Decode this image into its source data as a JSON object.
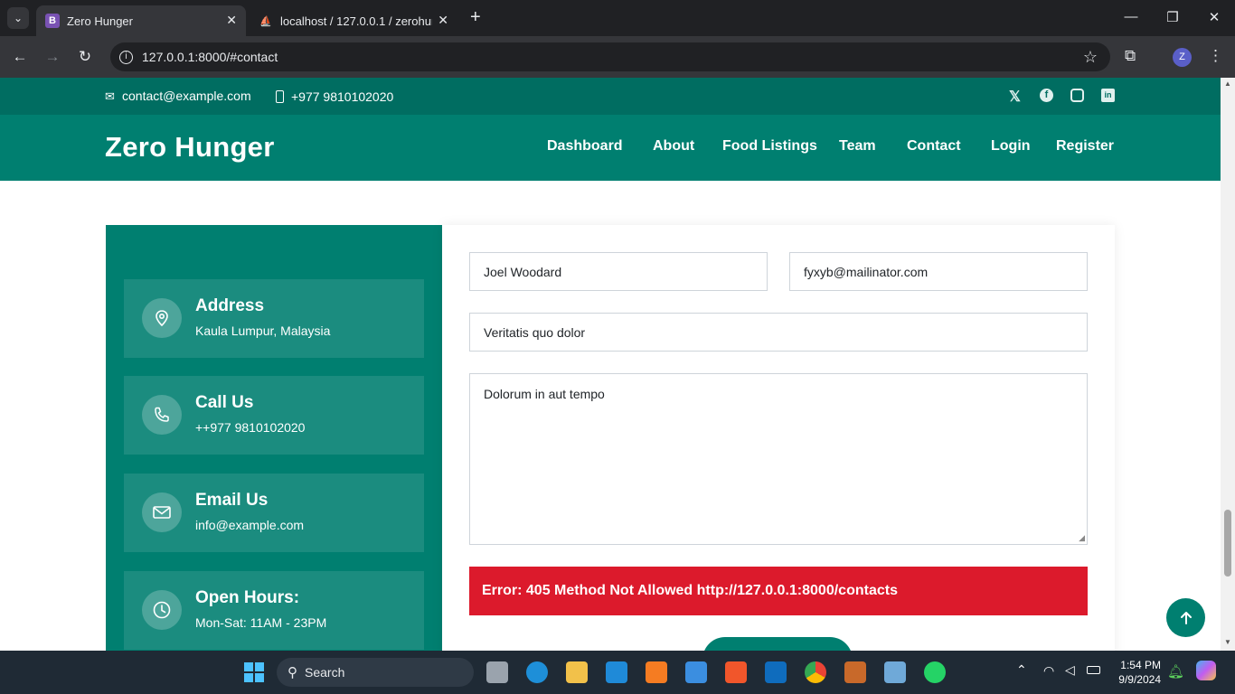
{
  "browser": {
    "tabs": [
      {
        "label": "Zero Hunger",
        "favicon": "B",
        "active": true
      },
      {
        "label": "localhost / 127.0.0.1 / zerohung",
        "active": false
      }
    ],
    "new_tab": "+",
    "url": "127.0.0.1:8000/#contact"
  },
  "topbar": {
    "email": "contact@example.com",
    "phone": "+977 9810102020",
    "social": [
      "x-icon",
      "facebook-icon",
      "instagram-icon",
      "linkedin-icon"
    ]
  },
  "nav": {
    "brand": "Zero Hunger",
    "links": [
      "Dashboard",
      "About",
      "Food Listings",
      "Team",
      "Contact",
      "Login",
      "Register"
    ]
  },
  "contact_info": [
    {
      "title": "Address",
      "text": "Kaula Lumpur, Malaysia",
      "icon": "map-pin-icon"
    },
    {
      "title": "Call Us",
      "text": "++977 9810102020",
      "icon": "phone-icon"
    },
    {
      "title": "Email Us",
      "text": "info@example.com",
      "icon": "envelope-icon"
    },
    {
      "title": "Open Hours:",
      "text": "Mon-Sat: 11AM - 23PM",
      "icon": "clock-icon"
    }
  ],
  "form": {
    "name": "Joel Woodard",
    "email": "fyxyb@mailinator.com",
    "subject": "Veritatis quo dolor",
    "message": "Dolorum in aut tempo",
    "error": "Error: 405 Method Not Allowed http://127.0.0.1:8000/contacts"
  },
  "taskbar": {
    "search": "Search",
    "time": "1:54 PM",
    "date": "9/9/2024"
  },
  "colors": {
    "primary": "#007f70",
    "topbar": "#006d61",
    "card": "#1b8c7f",
    "error": "#dc1a2c"
  }
}
